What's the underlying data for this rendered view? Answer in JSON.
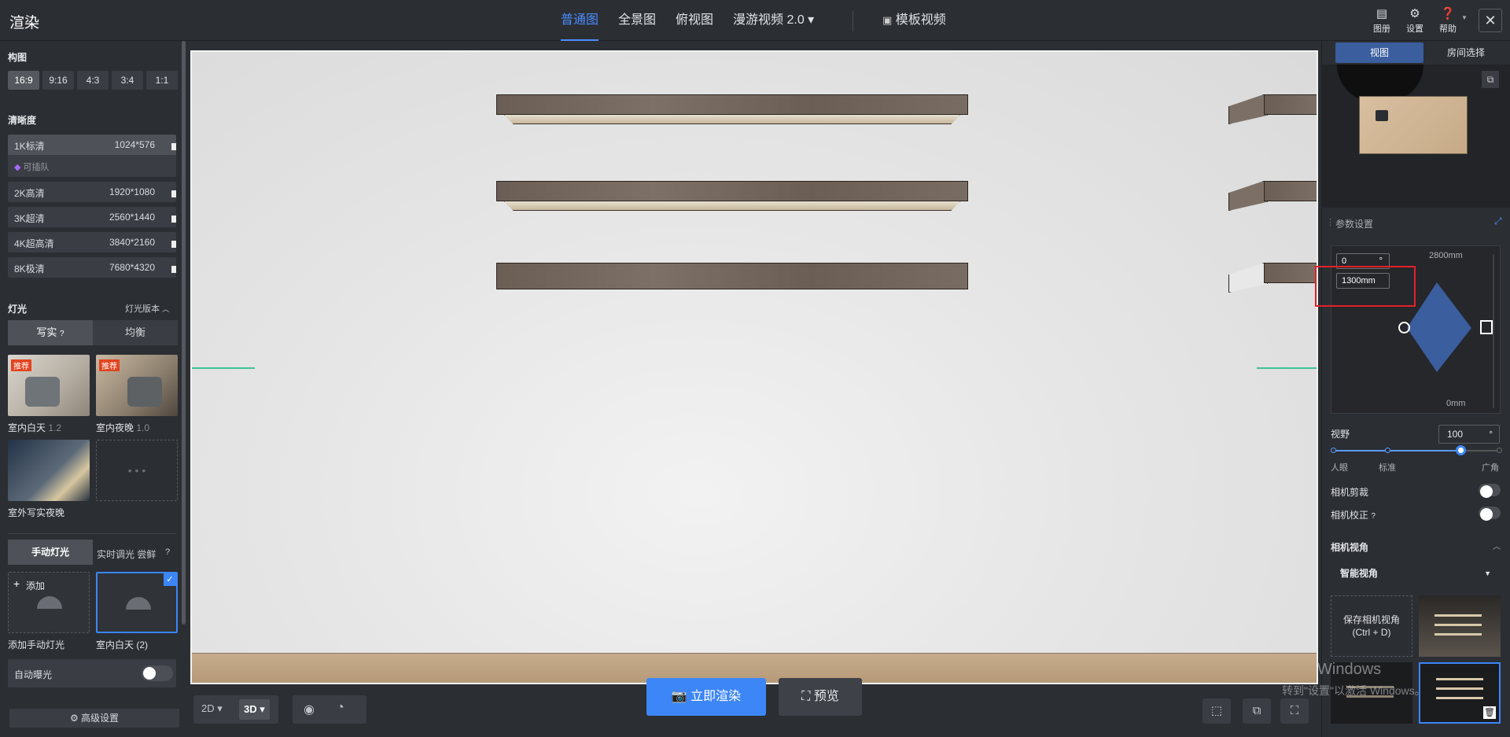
{
  "app_title": "渲染",
  "tabs": [
    {
      "label": "普通图",
      "active": true
    },
    {
      "label": "全景图"
    },
    {
      "label": "俯视图"
    },
    {
      "label": "漫游视频 2.0 ▾"
    }
  ],
  "template_video": "模板视频",
  "top_right": {
    "gallery": "图册",
    "settings": "设置",
    "help": "帮助"
  },
  "left": {
    "composition_title": "构图",
    "ratios": [
      "16:9",
      "9:16",
      "4:3",
      "3:4",
      "1:1"
    ],
    "clarity_title": "清晰度",
    "resolutions": [
      {
        "name": "1K标清",
        "value": "1024*576"
      },
      {
        "name": "2K高清",
        "value": "1920*1080"
      },
      {
        "name": "3K超清",
        "value": "2560*1440"
      },
      {
        "name": "4K超高清",
        "value": "3840*2160"
      },
      {
        "name": "8K极清",
        "value": "7680*4320"
      }
    ],
    "queue_label": "可插队",
    "light_title": "灯光",
    "light_version": "灯光版本",
    "light_modes": [
      "写实",
      "均衡"
    ],
    "presets": [
      {
        "name": "室内白天",
        "version": "1.2",
        "badge": "推荐"
      },
      {
        "name": "室内夜晚",
        "version": "1.0",
        "badge": "推荐"
      },
      {
        "name": "室外写实夜晚",
        "version": ""
      }
    ],
    "manual_light": "手动灯光",
    "realtime": "实时调光 尝鲜",
    "add_label": "添加",
    "add_manual_caption": "添加手动灯光",
    "manual_item_caption": "室内白天 (2)",
    "auto_exposure": "自动曝光",
    "advanced": "高级设置"
  },
  "bottom": {
    "mode_2d": "2D",
    "mode_3d": "3D",
    "render_now": "立即渲染",
    "preview": "预览"
  },
  "right": {
    "tab_view": "视图",
    "tab_room": "房间选择",
    "params_title": "参数设置",
    "angle": "0",
    "angle_unit": "°",
    "height": "1300mm",
    "max_height": "2800mm",
    "min_height": "0mm",
    "fov_label": "视野",
    "fov_value": "100",
    "fov_unit": "°",
    "fov_ticks": [
      "人眼",
      "标准",
      "广角"
    ],
    "camera_clip": "相机剪裁",
    "camera_correct": "相机校正",
    "camera_angle_title": "相机视角",
    "smart_angle": "智能视角",
    "save_camera_line1": "保存相机视角",
    "save_camera_line2": "(Ctrl + D)"
  },
  "watermark": {
    "line1": "Windows",
    "line2": "转到\"设置\"以激活 Windows。"
  }
}
